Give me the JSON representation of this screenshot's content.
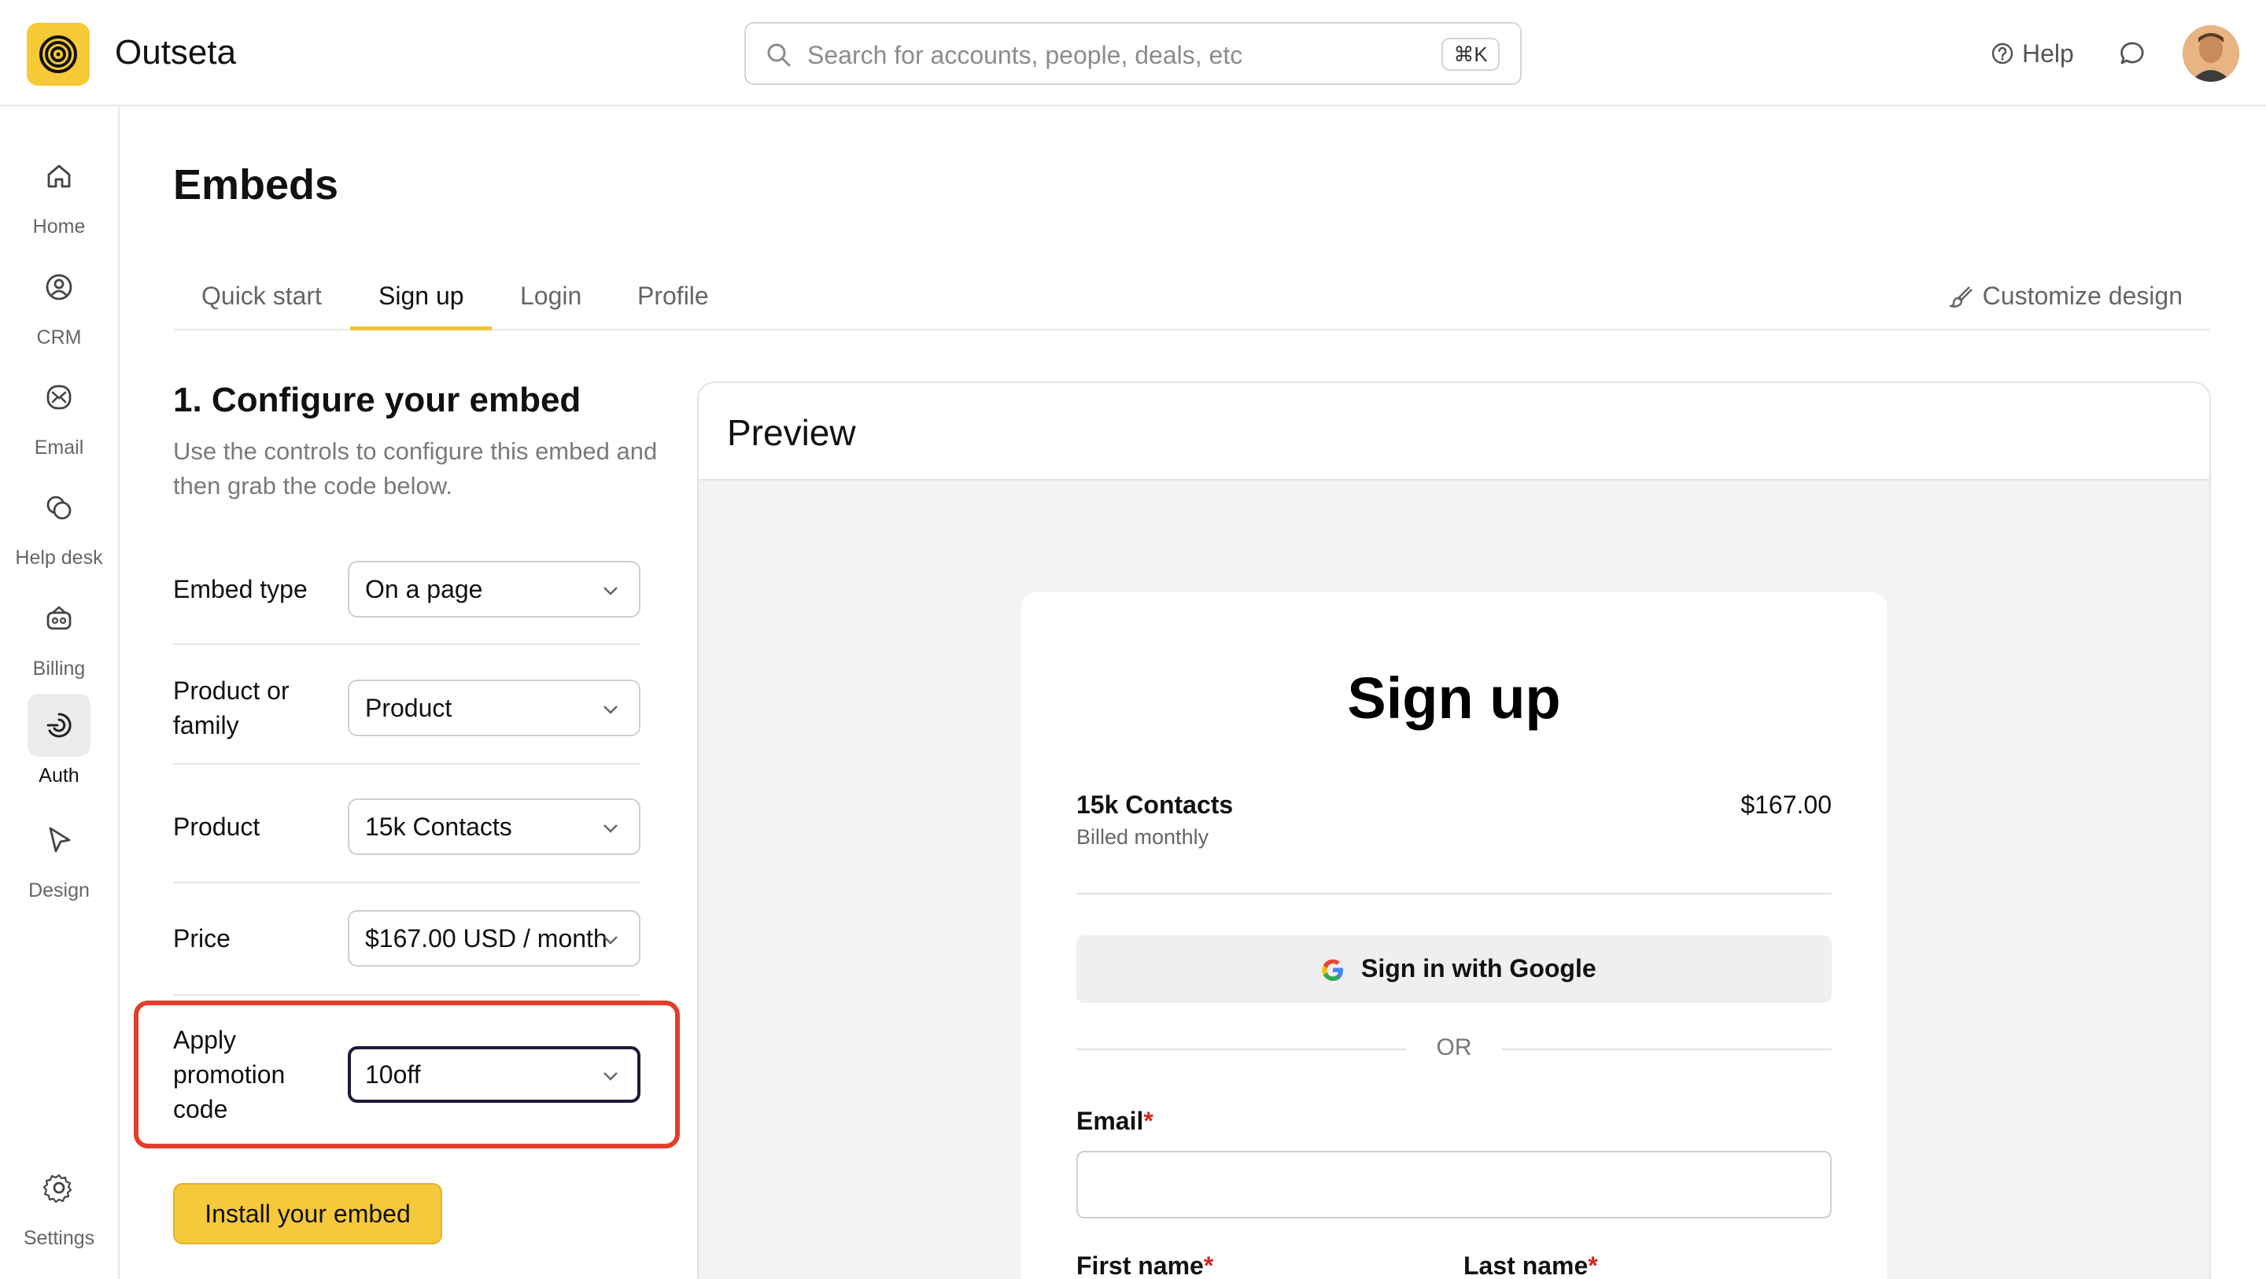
{
  "app": {
    "name": "Outseta"
  },
  "search": {
    "placeholder": "Search for accounts, people, deals, etc",
    "shortcut": "⌘K"
  },
  "header": {
    "help_label": "Help"
  },
  "sidebar": {
    "items": [
      {
        "label": "Home",
        "icon": "home-icon"
      },
      {
        "label": "CRM",
        "icon": "crm-icon"
      },
      {
        "label": "Email",
        "icon": "email-icon"
      },
      {
        "label": "Help desk",
        "icon": "help-desk-icon"
      },
      {
        "label": "Billing",
        "icon": "billing-icon"
      },
      {
        "label": "Auth",
        "icon": "auth-icon",
        "active": true
      },
      {
        "label": "Design",
        "icon": "design-icon"
      }
    ],
    "settings_label": "Settings"
  },
  "page": {
    "title": "Embeds"
  },
  "tabs": {
    "items": [
      "Quick start",
      "Sign up",
      "Login",
      "Profile"
    ],
    "active": "Sign up",
    "customize_label": "Customize design"
  },
  "config": {
    "title": "1. Configure your embed",
    "subtitle": "Use the controls to configure this embed and then grab the code below.",
    "embed_type": {
      "label": "Embed type",
      "value": "On a page"
    },
    "product_or_family": {
      "label": "Product or family",
      "value": "Product"
    },
    "product": {
      "label": "Product",
      "value": "15k Contacts"
    },
    "price": {
      "label": "Price",
      "value": "$167.00 USD / month"
    },
    "promotion": {
      "label": "Apply promotion code",
      "value": "10off"
    },
    "install_label": "Install your embed"
  },
  "preview": {
    "title": "Preview",
    "form": {
      "title": "Sign up",
      "plan_name": "15k Contacts",
      "billing": "Billed monthly",
      "price": "$167.00",
      "google_label": "Sign in with Google",
      "or_label": "OR",
      "email_label": "Email",
      "first_name_label": "First name",
      "last_name_label": "Last name",
      "required_marker": "*"
    }
  },
  "colors": {
    "accent": "#f5c93b",
    "highlight": "#e43d2b",
    "required": "#d8261c"
  }
}
